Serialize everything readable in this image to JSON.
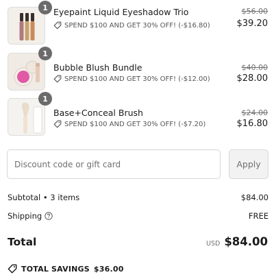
{
  "items": [
    {
      "name": "Eyepaint Liquid Eyeshadow Trio",
      "quantity": "1",
      "discount": "SPEND $100 AND GET 30% OFF! (-$16.80)",
      "original_price": "$56.00",
      "price": "$39.20",
      "image": "eyeshadow-trio-image"
    },
    {
      "name": "Bubble Blush Bundle",
      "quantity": "1",
      "discount": "SPEND $100 AND GET 30% OFF! (-$12.00)",
      "original_price": "$40.00",
      "price": "$28.00",
      "image": "blush-bundle-image"
    },
    {
      "name": "Base+Conceal Brush",
      "quantity": "1",
      "discount": "SPEND $100 AND GET 30% OFF! (-$7.20)",
      "original_price": "$24.00",
      "price": "$16.80",
      "image": "brush-image"
    }
  ],
  "discount_field": {
    "placeholder": "Discount code or gift card",
    "value": "",
    "apply_label": "Apply"
  },
  "summary": {
    "subtotal_label": "Subtotal • 3 items",
    "subtotal_value": "$84.00",
    "shipping_label": "Shipping",
    "shipping_value": "FREE",
    "total_label": "Total",
    "currency": "USD",
    "total_value": "$84.00"
  },
  "savings": {
    "label": "TOTAL SAVINGS",
    "value": "$36.00"
  },
  "icons": {
    "tag": "tag-icon",
    "help": "question-circle-icon"
  },
  "colors": {
    "badge": "#6b6b6b",
    "muted_text": "#707070",
    "border": "#d6d6d6"
  }
}
